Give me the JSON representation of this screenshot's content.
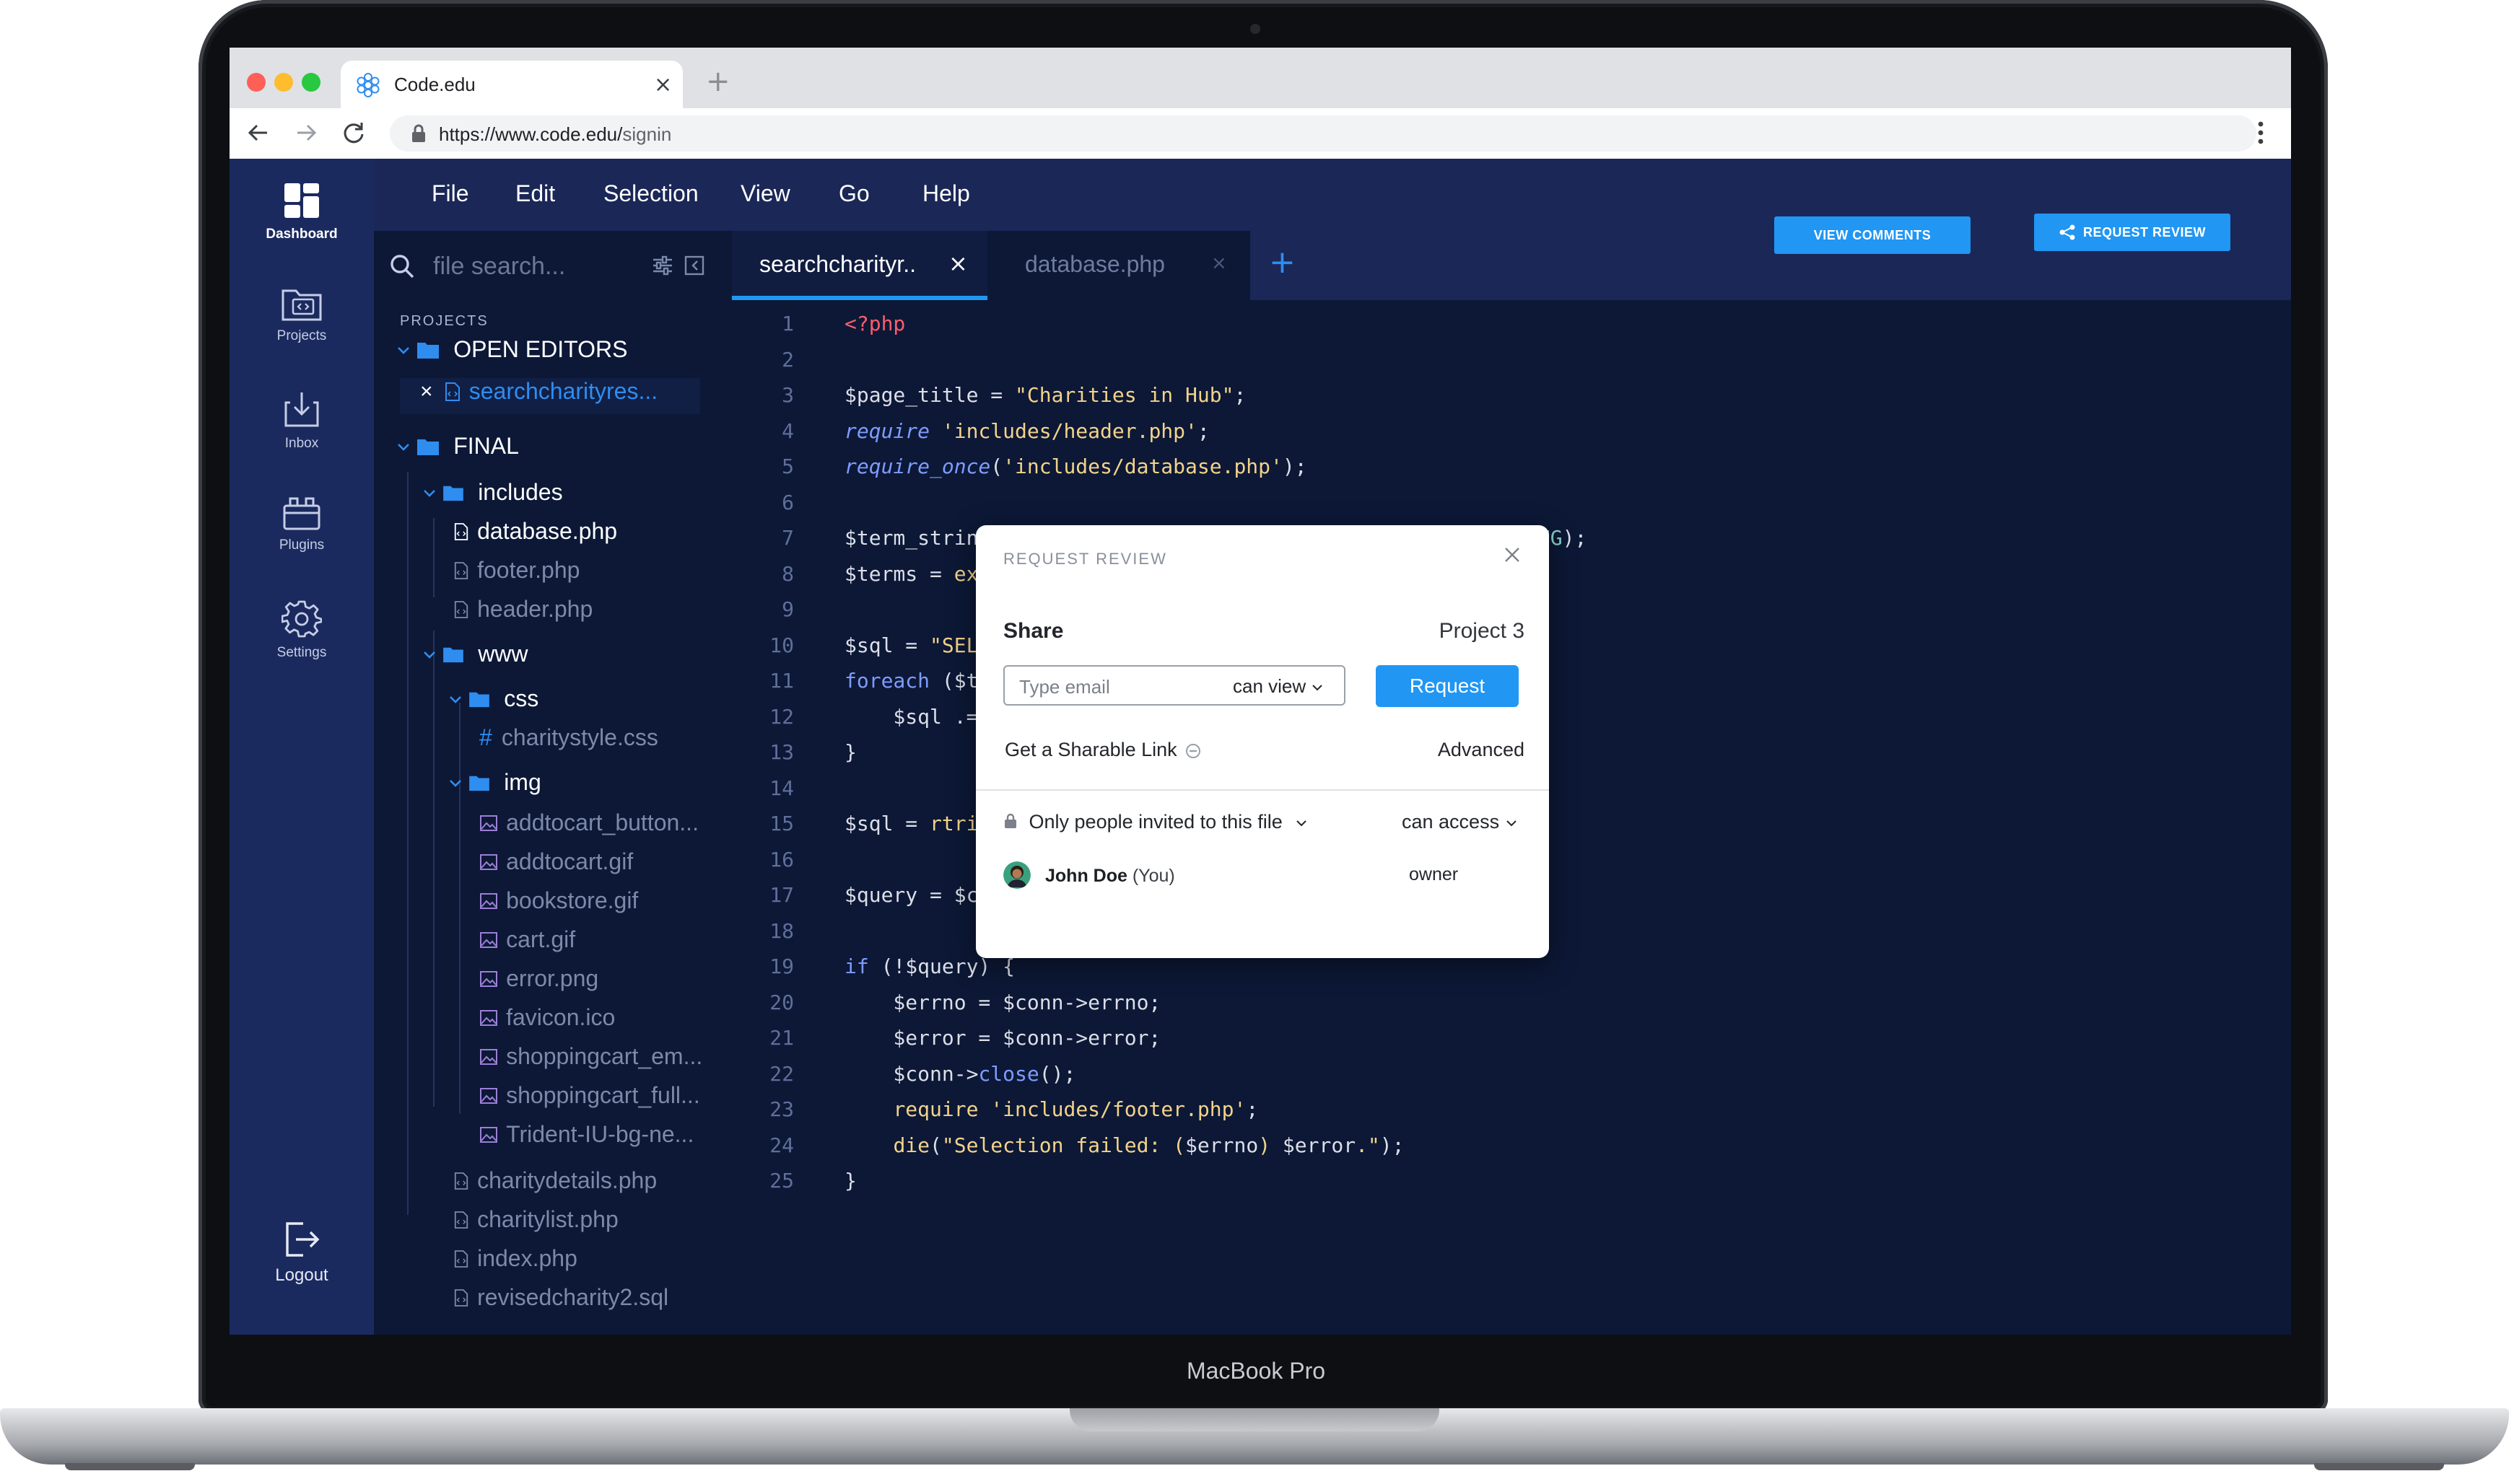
{
  "device": {
    "model": "MacBook Pro"
  },
  "browser": {
    "tab_title": "Code.edu",
    "new_tab": "+",
    "close": "×",
    "url_prefix": "https://www.code.edu/",
    "url_path": "signin"
  },
  "sidebar": {
    "items": [
      {
        "label": "Dashboard",
        "icon": "dashboard-icon",
        "active": true
      },
      {
        "label": "Projects",
        "icon": "projects-folder-icon"
      },
      {
        "label": "Inbox",
        "icon": "inbox-icon"
      },
      {
        "label": "Plugins",
        "icon": "plugins-icon"
      },
      {
        "label": "Settings",
        "icon": "settings-gear-icon"
      }
    ],
    "logout": "Logout"
  },
  "menu": [
    "File",
    "Edit",
    "Selection",
    "View",
    "Go",
    "Help"
  ],
  "actions": {
    "view_comments": "VIEW COMMENTS",
    "request_review": "REQUEST REVIEW"
  },
  "search": {
    "placeholder": "file search..."
  },
  "tabs": [
    {
      "label": "searchcharityr..",
      "active": true
    },
    {
      "label": "database.php",
      "active": false
    }
  ],
  "add_tab": "+",
  "explorer": {
    "heading": "PROJECTS",
    "open_editors": "OPEN EDITORS",
    "open_file": "searchcharityres...",
    "root": "FINAL",
    "includes": "includes",
    "includes_files": [
      "database.php",
      "footer.php",
      "header.php"
    ],
    "www": "www",
    "css": "css",
    "css_files": [
      "charitystyle.css"
    ],
    "img": "img",
    "img_files": [
      "addtocart_button...",
      "addtocart.gif",
      "bookstore.gif",
      "cart.gif",
      "error.png",
      "favicon.ico",
      "shoppingcart_em...",
      "shoppingcart_full...",
      "Trident-IU-bg-ne..."
    ],
    "www_files": [
      "charitydetails.php",
      "charitylist.php",
      "index.php",
      "revisedcharity2.sql"
    ]
  },
  "code": {
    "line_numbers": [
      "1",
      "2",
      "3",
      "4",
      "5",
      "6",
      "7",
      "8",
      "9",
      "10",
      "11",
      "12",
      "13",
      "14",
      "15",
      "16",
      "17",
      "18",
      "19",
      "20",
      "21",
      "22",
      "23",
      "24",
      "25"
    ],
    "lines": [
      [
        {
          "t": "<?php",
          "c": "#ff5c6c"
        }
      ],
      [],
      [
        {
          "t": "$page_title = ",
          "c": "#dcdfe8"
        },
        {
          "t": "\"Charities in Hub\"",
          "c": "#f3d38a"
        },
        {
          "t": ";",
          "c": "#dcdfe8"
        }
      ],
      [
        {
          "t": "require",
          "c": "#7f9cff",
          "i": true
        },
        {
          "t": " ",
          "c": "#dcdfe8"
        },
        {
          "t": "'includes/header.php'",
          "c": "#f3d38a"
        },
        {
          "t": ";",
          "c": "#dcdfe8"
        }
      ],
      [
        {
          "t": "require_once",
          "c": "#7f9cff",
          "i": true
        },
        {
          "t": "(",
          "c": "#dcdfe8"
        },
        {
          "t": "'includes/database.php'",
          "c": "#f3d38a"
        },
        {
          "t": ");",
          "c": "#dcdfe8"
        }
      ],
      [],
      [
        {
          "t": "$term_strin",
          "c": "#dcdfe8"
        },
        {
          "t": "                                   ",
          "c": "#dcdfe8"
        },
        {
          "t": "NITIZE_STRING",
          "c": "#8ad3c8"
        },
        {
          "t": ");",
          "c": "#dcdfe8"
        }
      ],
      [
        {
          "t": "$terms = ",
          "c": "#dcdfe8"
        },
        {
          "t": "ex",
          "c": "#f3d38a"
        }
      ],
      [],
      [
        {
          "t": "$sql = ",
          "c": "#dcdfe8"
        },
        {
          "t": "\"SEL",
          "c": "#f3d38a"
        }
      ],
      [
        {
          "t": "foreach",
          "c": "#7f9cff"
        },
        {
          "t": " ($t",
          "c": "#dcdfe8"
        }
      ],
      [
        {
          "t": "    $sql .=",
          "c": "#dcdfe8"
        }
      ],
      [
        {
          "t": "}",
          "c": "#dcdfe8"
        }
      ],
      [],
      [
        {
          "t": "$sql = ",
          "c": "#dcdfe8"
        },
        {
          "t": "rtri",
          "c": "#f3d38a"
        }
      ],
      [],
      [
        {
          "t": "$query = $c",
          "c": "#dcdfe8"
        }
      ],
      [],
      [
        {
          "t": "if",
          "c": "#7f9cff"
        },
        {
          "t": " (!$query) {",
          "c": "#dcdfe8"
        }
      ],
      [
        {
          "t": "    $errno = $conn->errno;",
          "c": "#dcdfe8"
        }
      ],
      [
        {
          "t": "    $error = $conn->error;",
          "c": "#dcdfe8"
        }
      ],
      [
        {
          "t": "    $conn->",
          "c": "#dcdfe8"
        },
        {
          "t": "close",
          "c": "#7f9cff"
        },
        {
          "t": "();",
          "c": "#dcdfe8"
        }
      ],
      [
        {
          "t": "    ",
          "c": "#dcdfe8"
        },
        {
          "t": "require",
          "c": "#f3d38a"
        },
        {
          "t": " ",
          "c": "#dcdfe8"
        },
        {
          "t": "'includes/footer.php'",
          "c": "#f3d38a"
        },
        {
          "t": ";",
          "c": "#dcdfe8"
        }
      ],
      [
        {
          "t": "    ",
          "c": "#dcdfe8"
        },
        {
          "t": "die",
          "c": "#f3d38a"
        },
        {
          "t": "(",
          "c": "#dcdfe8"
        },
        {
          "t": "\"Selection failed: (",
          "c": "#f3d38a"
        },
        {
          "t": "$errno",
          "c": "#dcdfe8"
        },
        {
          "t": ") ",
          "c": "#f3d38a"
        },
        {
          "t": "$error",
          "c": "#dcdfe8"
        },
        {
          "t": ".\"",
          "c": "#f3d38a"
        },
        {
          "t": ");",
          "c": "#dcdfe8"
        }
      ],
      [
        {
          "t": "}",
          "c": "#dcdfe8"
        }
      ]
    ]
  },
  "modal": {
    "title": "REQUEST REVIEW",
    "share": "Share",
    "project": "Project 3",
    "email_placeholder": "Type email",
    "permission": "can view",
    "request": "Request",
    "sharable_link": "Get a Sharable Link",
    "advanced": "Advanced",
    "access_scope": "Only people invited to this file",
    "access_level": "can access",
    "user_name": "John Doe",
    "user_you": "(You)",
    "user_role": "owner"
  },
  "colors": {
    "accent": "#2196f3",
    "sidebar": "#1b2a5e",
    "editor_bg": "#0c1836",
    "folder": "#2f8df0"
  }
}
